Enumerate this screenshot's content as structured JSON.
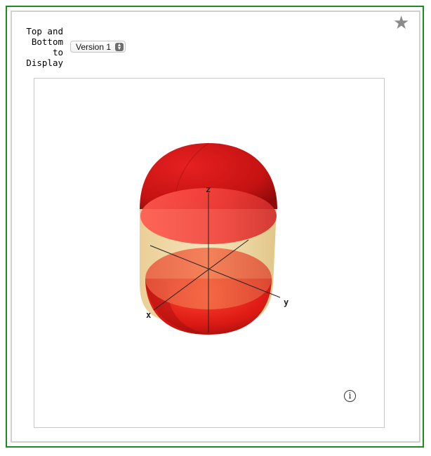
{
  "control": {
    "label": "Top and\nBottom\nto\nDisplay",
    "selected": "Version 1"
  },
  "plot": {
    "axes": {
      "x": "x",
      "y": "y",
      "z": "z"
    },
    "colors": {
      "caps": "#e01515",
      "cylinder": "#e9cf8e",
      "axis": "#222222"
    }
  },
  "icons": {
    "favorite": "star-icon",
    "info": "info-icon"
  },
  "info_glyph": "i",
  "star_glyph": "★"
}
